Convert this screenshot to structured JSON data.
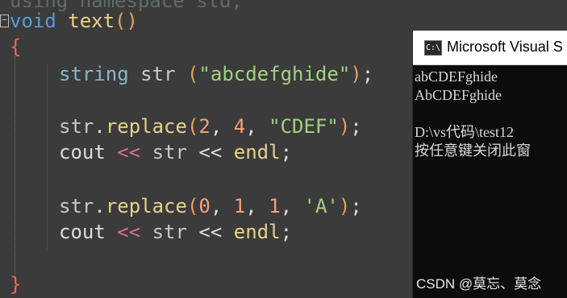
{
  "editor": {
    "cut_line": "using namespace std;",
    "fold_glyph": "−",
    "func_kw": "void",
    "func_name": "text",
    "func_parens": "()",
    "open_brace": "{",
    "close_brace": "}",
    "line_string": {
      "type": "string",
      "var": "str",
      "paren_open": "(",
      "literal": "\"abcdefghide\"",
      "paren_close": ")",
      "semi": ";"
    },
    "line_replace1": {
      "obj": "str",
      "dot": ".",
      "method": "replace",
      "paren_open": "(",
      "arg1": "2",
      "sep1": ", ",
      "arg2": "4",
      "sep2": ", ",
      "arg3": "\"CDEF\"",
      "paren_close": ")",
      "semi": ";"
    },
    "line_cout1": {
      "cout": "cout",
      "op1": "<<",
      "var": "str",
      "op2": "<<",
      "endl": "endl",
      "semi": ";"
    },
    "line_replace2": {
      "obj": "str",
      "dot": ".",
      "method": "replace",
      "paren_open": "(",
      "arg1": "0",
      "sep1": ", ",
      "arg2": "1",
      "sep2": ", ",
      "arg3": "1",
      "sep3": ", ",
      "arg4": "'A'",
      "paren_close": ")",
      "semi": ";"
    },
    "line_cout2": {
      "cout": "cout",
      "op1": "<<",
      "var": "str",
      "op2": "<<",
      "endl": "endl",
      "semi": ";"
    }
  },
  "console": {
    "title": "Microsoft Visual S",
    "icon_text": "C:\\",
    "lines": [
      "abCDEFghide",
      "AbCDEFghide",
      "",
      "D:\\vs代码\\test12",
      "按任意键关闭此窗"
    ]
  },
  "watermark": "CSDN @莫忘、莫念",
  "colors": {
    "editor_bg": "#3b3b3b",
    "keyword": "#569cd6",
    "function": "#e8d28a",
    "string": "#9fd37f",
    "number": "#f2a27a",
    "operator": "#e06a8f",
    "console_bg": "#0c0c0c"
  }
}
